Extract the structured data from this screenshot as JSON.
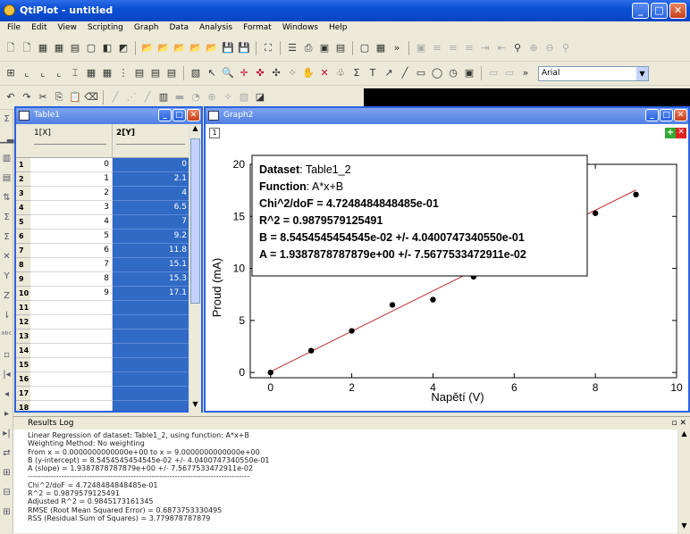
{
  "app_title": "QtiPlot - untitled",
  "menu": [
    "File",
    "Edit",
    "View",
    "Scripting",
    "Graph",
    "Data",
    "Analysis",
    "Format",
    "Windows",
    "Help"
  ],
  "font_box": "Arial",
  "table_window": {
    "title": "Table1",
    "col1_header": "1[X]",
    "col2_header": "2[Y]",
    "rows": [
      {
        "n": "1",
        "x": "0",
        "y": "0"
      },
      {
        "n": "2",
        "x": "1",
        "y": "2.1"
      },
      {
        "n": "3",
        "x": "2",
        "y": "4"
      },
      {
        "n": "4",
        "x": "3",
        "y": "6.5"
      },
      {
        "n": "5",
        "x": "4",
        "y": "7"
      },
      {
        "n": "6",
        "x": "5",
        "y": "9.2"
      },
      {
        "n": "7",
        "x": "6",
        "y": "11.8"
      },
      {
        "n": "8",
        "x": "7",
        "y": "15.1"
      },
      {
        "n": "9",
        "x": "8",
        "y": "15.3"
      },
      {
        "n": "10",
        "x": "9",
        "y": "17.1"
      },
      {
        "n": "11",
        "x": "",
        "y": ""
      },
      {
        "n": "12",
        "x": "",
        "y": ""
      },
      {
        "n": "13",
        "x": "",
        "y": ""
      },
      {
        "n": "14",
        "x": "",
        "y": ""
      },
      {
        "n": "15",
        "x": "",
        "y": ""
      },
      {
        "n": "16",
        "x": "",
        "y": ""
      },
      {
        "n": "17",
        "x": "",
        "y": ""
      },
      {
        "n": "18",
        "x": "",
        "y": ""
      }
    ]
  },
  "graph_window": {
    "title": "Graph2",
    "layer_label": "1",
    "legend": {
      "dataset_label": "Dataset",
      "dataset_value": ": Table1_2",
      "function_label": "Function",
      "function_value": ": A*x+B",
      "line3": "Chi^2/doF = 4.7248484848485e-01",
      "line4": "R^2 = 0.9879579125491",
      "line5": "B = 8.5454545454545e-02 +/- 4.0400747340550e-01",
      "line6": "A = 1.9387878787879e+00 +/- 7.5677533472911e-02"
    }
  },
  "chart_data": {
    "type": "scatter",
    "xlabel": "Napětí (V)",
    "ylabel": "Proud (mA)",
    "xlim": [
      -0.5,
      10
    ],
    "ylim": [
      -0.5,
      20
    ],
    "xticks": [
      0,
      2,
      4,
      6,
      8,
      10
    ],
    "yticks": [
      0,
      5,
      10,
      15,
      20
    ],
    "points": [
      [
        0,
        0
      ],
      [
        1,
        2.1
      ],
      [
        2,
        4
      ],
      [
        3,
        6.5
      ],
      [
        4,
        7
      ],
      [
        5,
        9.2
      ],
      [
        6,
        11.8
      ],
      [
        7,
        15.1
      ],
      [
        8,
        15.3
      ],
      [
        9,
        17.1
      ]
    ],
    "fit": {
      "A": 1.9387878787879,
      "B": 0.085454545454545,
      "x_from": 0,
      "x_to": 9,
      "color": "#c03030"
    },
    "point_color": "#000000"
  },
  "results_log": {
    "title": "Results Log",
    "lines": [
      "Linear Regression of dataset: Table1_2, using function: A*x+B",
      "Weighting Method: No weighting",
      "From x = 0.0000000000000e+00 to x = 9.0000000000000e+00",
      "B (y-intercept) = 8.5454545454545e-02 +/- 4.0400747340550e-01",
      "A (slope) = 1.9387878787879e+00 +/- 7.5677533472911e-02",
      "--------------------------------------------------------------------------------------",
      "Chi^2/doF = 4.7248484848485e-01",
      "R^2 = 0.9879579125491",
      "Adjusted R^2 = 0.9845173161345",
      "RMSE (Root Mean Squared Error) = 0.6873753330495",
      "RSS (Residual Sum of Squares) = 3.779878787879"
    ]
  }
}
